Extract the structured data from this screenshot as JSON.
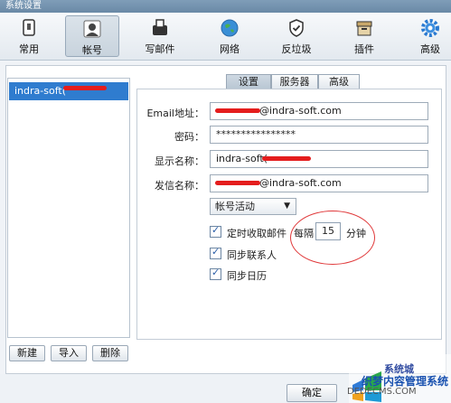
{
  "window": {
    "title": "系统设置"
  },
  "toolbar": {
    "items": [
      {
        "label": "常用",
        "icon": "general-settings-icon"
      },
      {
        "label": "帐号",
        "icon": "account-icon",
        "active": true
      },
      {
        "label": "写邮件",
        "icon": "compose-mail-icon"
      },
      {
        "label": "网络",
        "icon": "network-globe-icon"
      },
      {
        "label": "反垃圾",
        "icon": "anti-spam-shield-icon"
      },
      {
        "label": "插件",
        "icon": "plugin-box-icon"
      },
      {
        "label": "高级",
        "icon": "advanced-gear-icon"
      }
    ]
  },
  "accounts": {
    "items": [
      {
        "label": "indra-soft("
      }
    ],
    "buttons": {
      "new": "新建",
      "import": "导入",
      "delete": "删除"
    }
  },
  "tabs": [
    {
      "label": "设置",
      "active": true
    },
    {
      "label": "服务器"
    },
    {
      "label": "高级"
    }
  ],
  "form": {
    "email": {
      "label": "Email地址：",
      "value": "@indra-soft.com"
    },
    "password": {
      "label": "密码：",
      "value": "****************"
    },
    "display_name": {
      "label": "显示名称：",
      "value": "indra-soft("
    },
    "sender_name": {
      "label": "发信名称：",
      "value": "@indra-soft.com"
    },
    "account_status": {
      "value": "帐号活动"
    },
    "auto_receive": {
      "label": "定时收取邮件",
      "checked": true,
      "every_label": "每隔",
      "interval": "15",
      "unit_label": "分钟"
    },
    "sync_contacts": {
      "label": "同步联系人",
      "checked": true
    },
    "sync_calendar": {
      "label": "同步日历",
      "checked": true
    }
  },
  "footer": {
    "ok": "确定"
  },
  "watermark": {
    "line1": "系统城",
    "line2": "织梦内容管理系统",
    "line3": "DEDECMS.COM"
  },
  "colors": {
    "selection": "#2f7ccf",
    "annotation": "#e0393a",
    "redaction": "#e41d1d"
  }
}
